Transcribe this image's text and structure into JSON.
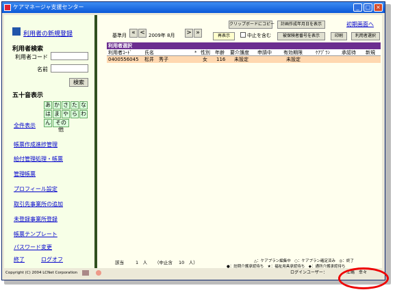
{
  "window": {
    "title": "ケアマネージャ支援センター",
    "btns": [
      "_",
      "□",
      "×"
    ]
  },
  "sidebar": {
    "register": "利用者の新規登録",
    "search_head": "利用者検索",
    "code_label": "利用者コード",
    "name_label": "名前",
    "code_value": "",
    "name_value": "",
    "search_btn": "検索",
    "kana_head": "五十音表示",
    "kana_row1": [
      "あ",
      "か",
      "さ",
      "た",
      "な"
    ],
    "kana_row2": [
      "は",
      "ま",
      "や",
      "ら",
      "わ"
    ],
    "kana_n": "ん",
    "kana_other": "その他",
    "show_all": "全件表示",
    "links": [
      "帳票作成進捗管理",
      "給付管理処理・帳票",
      "管理帳票",
      "プロフィール設定",
      "取引先事業所の追加",
      "未登録事業所登録",
      "帳票テンプレート",
      "パスワード変更"
    ],
    "exit": "終了",
    "logoff": "ログオフ"
  },
  "main": {
    "clipboard_btn": "クリップボードにコピー",
    "plan_btn": "計画作成年月日を表示",
    "init_link": "初期画面へ",
    "base_month_label": "基準月",
    "nav_first": "«",
    "nav_prev": "<",
    "year_month": "2009年 8月",
    "nav_next": ">",
    "nav_last": "»",
    "redisplay_btn": "再表示",
    "include_stop": "中止を含む",
    "insured_btn": "被保険者番号を表示",
    "print_btn": "印刷",
    "select_btn": "利用者選択",
    "table_title": "利用者選択",
    "columns": [
      "利用者ｺｰﾄﾞ",
      "氏名",
      "*",
      "性別",
      "年齢",
      "要介護度",
      "申請中",
      "有効期限",
      "ｹｱﾌﾟﾗﾝ",
      "承認待",
      "新規"
    ],
    "rows": [
      [
        "0400556045",
        "松井　秀子",
        "",
        "女",
        "116",
        "未設定",
        "",
        "未設定",
        "",
        "",
        ""
      ]
    ],
    "status_label": "該当",
    "status_count": "1　人",
    "status_stop": "（中止含",
    "status_stop_count": "10　人）",
    "legend1": "△：ケアプラン編集中　○：ケアプラン確定済み　◎：終了",
    "legend2": "●：訪問介護承認待ち　★：福祉用具承認待ち　◆：通所介護承認待ち"
  },
  "footer": {
    "copyright": "Copyright (C) 2004 LCNet Corporation",
    "login_label": "ログインユーザー：",
    "user": "江嶋　幸々"
  }
}
